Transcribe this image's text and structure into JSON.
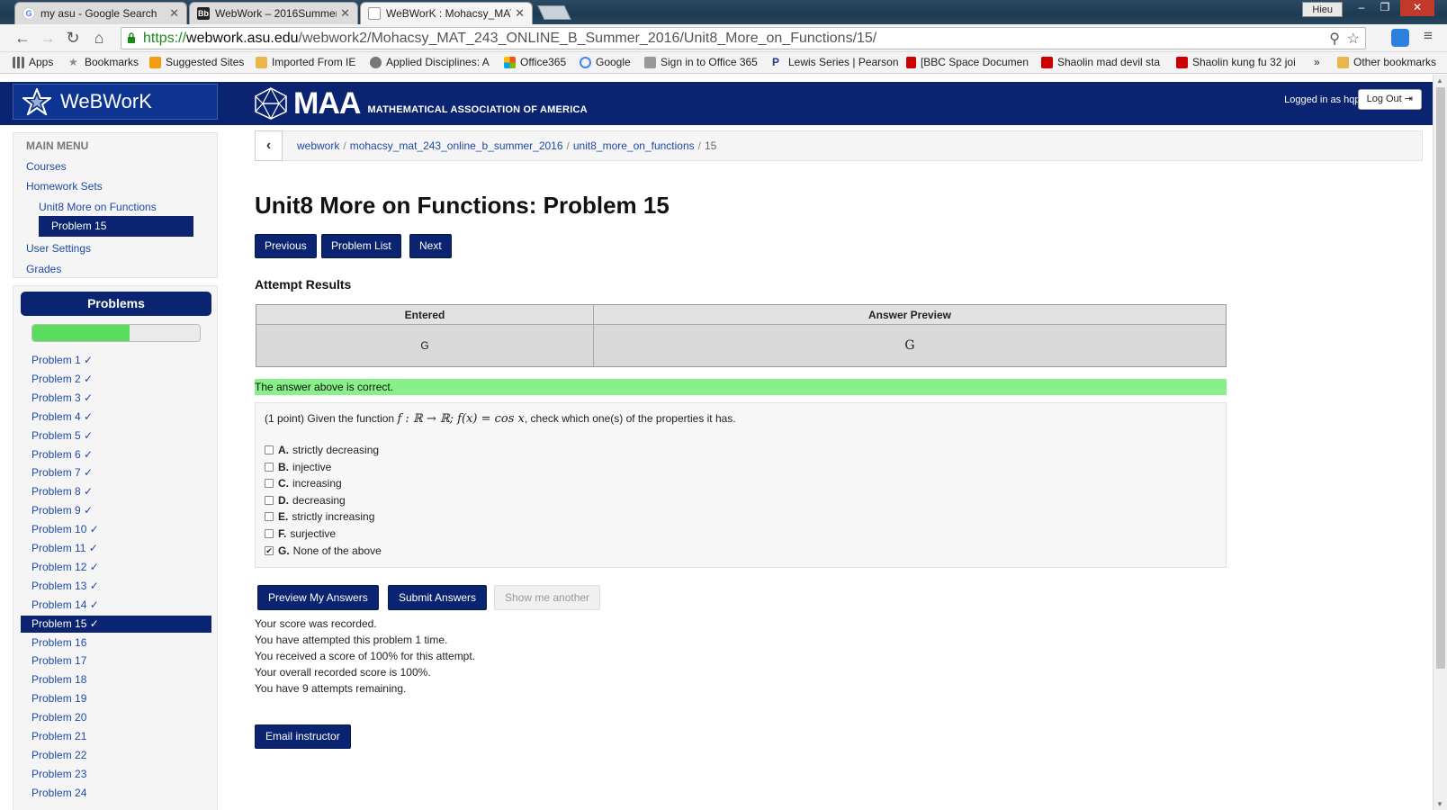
{
  "browser": {
    "tabs": [
      {
        "title": "my asu - Google Search",
        "favicon": "google-icon"
      },
      {
        "title": "WebWork – 2016Summer",
        "favicon": "blackboard-icon"
      },
      {
        "title": "WeBWorK : Mohacsy_MAT",
        "favicon": "page-icon"
      }
    ],
    "user": "Hieu",
    "url_scheme": "https://",
    "url_host": "webwork.asu.edu",
    "url_path": "/webwork2/Mohacsy_MAT_243_ONLINE_B_Summer_2016/Unit8_More_on_Functions/15/",
    "bookmarks": [
      "Apps",
      "Bookmarks",
      "Suggested Sites",
      "Imported From IE",
      "Applied Disciplines: A",
      "Office365",
      "Google",
      "Sign in to Office 365",
      "Lewis Series | Pearson",
      "[BBC Space Documen",
      "Shaolin mad devil sta",
      "Shaolin kung fu 32 joi",
      "»",
      "Other bookmarks"
    ]
  },
  "header": {
    "brand": "WeBWorK",
    "maa_big": "MAA",
    "maa_small": "MATHEMATICAL ASSOCIATION OF AMERICA",
    "logged_in": "Logged in as hqpham.",
    "logout": "Log Out"
  },
  "main_menu": {
    "title": "MAIN MENU",
    "courses": "Courses",
    "homework_sets": "Homework Sets",
    "set_name": "Unit8 More on Functions",
    "problem": "Problem 15",
    "user_settings": "User Settings",
    "grades": "Grades"
  },
  "problems_panel": {
    "title": "Problems",
    "progress_fraction": 0.58,
    "items": [
      "Problem 1 ✓",
      "Problem 2 ✓",
      "Problem 3 ✓",
      "Problem 4 ✓",
      "Problem 5 ✓",
      "Problem 6 ✓",
      "Problem 7 ✓",
      "Problem 8 ✓",
      "Problem 9 ✓",
      "Problem 10 ✓",
      "Problem 11 ✓",
      "Problem 12 ✓",
      "Problem 13 ✓",
      "Problem 14 ✓",
      "Problem 15 ✓",
      "Problem 16",
      "Problem 17",
      "Problem 18",
      "Problem 19",
      "Problem 20",
      "Problem 21",
      "Problem 22",
      "Problem 23",
      "Problem 24"
    ],
    "current_index": 14
  },
  "breadcrumb": {
    "items": [
      "webwork",
      "mohacsy_mat_243_online_b_summer_2016",
      "unit8_more_on_functions"
    ],
    "current": "15"
  },
  "page_title": "Unit8 More on Functions: Problem 15",
  "nav": {
    "previous": "Previous",
    "problem_list": "Problem List",
    "next": "Next"
  },
  "attempt": {
    "heading": "Attempt Results",
    "col_entered": "Entered",
    "col_preview": "Answer Preview",
    "entered": "G",
    "preview": "G",
    "correct_msg": "The answer above is correct."
  },
  "question": {
    "points": "(1 point) Given the function",
    "math": "f : ℝ → ℝ; f(x) = cos x",
    "tail": ", check which one(s) of the properties it has.",
    "options": [
      {
        "letter": "A.",
        "text": "strictly decreasing",
        "checked": false
      },
      {
        "letter": "B.",
        "text": "injective",
        "checked": false
      },
      {
        "letter": "C.",
        "text": "increasing",
        "checked": false
      },
      {
        "letter": "D.",
        "text": "decreasing",
        "checked": false
      },
      {
        "letter": "E.",
        "text": "strictly increasing",
        "checked": false
      },
      {
        "letter": "F.",
        "text": "surjective",
        "checked": false
      },
      {
        "letter": "G.",
        "text": "None of the above",
        "checked": true
      }
    ]
  },
  "actions": {
    "preview": "Preview My Answers",
    "submit": "Submit Answers",
    "show_another": "Show me another"
  },
  "score_lines": [
    "Your score was recorded.",
    "You have attempted this problem 1 time.",
    "You received a score of 100% for this attempt.",
    "Your overall recorded score is 100%.",
    "You have 9 attempts remaining."
  ],
  "email_instructor": "Email instructor",
  "colors": {
    "navy": "#0a2472",
    "correct_bg": "#88f088",
    "progress": "#5cdc5c"
  }
}
